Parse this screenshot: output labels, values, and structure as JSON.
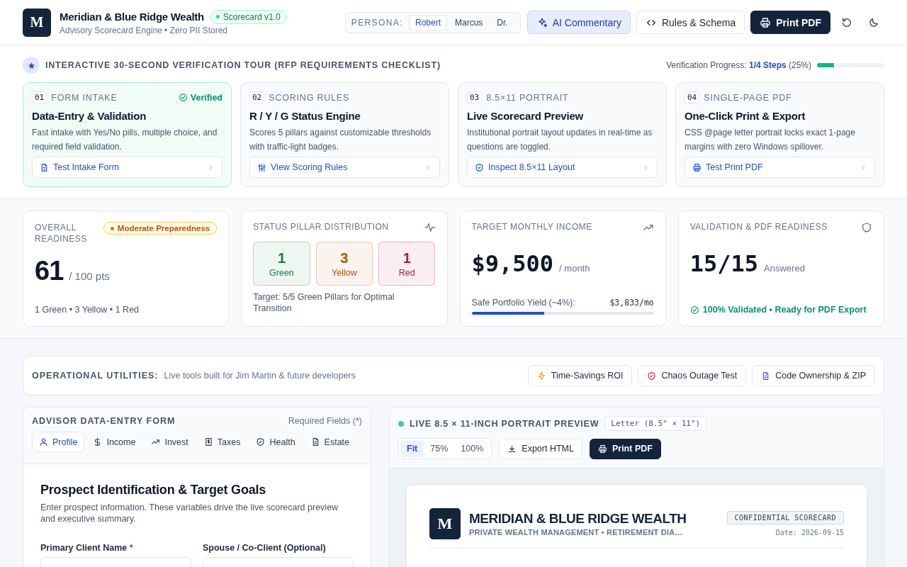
{
  "header": {
    "logo": "M",
    "title": "Meridian & Blue Ridge Wealth",
    "version": "Scorecard v1.0",
    "subtitle": "Advisory Scorecard Engine • Zero PII Stored",
    "persona": {
      "label": "PERSONA:",
      "options": [
        {
          "label": "Robert",
          "selected": true
        },
        {
          "label": "Marcus",
          "selected": false
        },
        {
          "label": "Dr.",
          "selected": false
        }
      ]
    },
    "buttons": [
      {
        "label": "AI Commentary",
        "kind": "accent"
      },
      {
        "label": "Rules & Schema",
        "kind": "outline"
      },
      {
        "label": "Print PDF",
        "kind": "dark"
      }
    ]
  },
  "tour": {
    "title": "INTERACTIVE 30-SECOND VERIFICATION TOUR (RFP REQUIREMENTS CHECKLIST)",
    "progress_label": "Verification Progress:",
    "progress_steps": "1/4 Steps",
    "progress_percent": "(25%)",
    "level": 0.25,
    "cards": [
      {
        "number": "01",
        "category": "FORM INTAKE",
        "verified": true,
        "verified_label": "Verified",
        "title": "Data-Entry & Validation",
        "description": "Fast intake with Yes/No pills, multiple choice, and required field validation.",
        "action": "Test Intake Form"
      },
      {
        "number": "02",
        "category": "SCORING RULES",
        "verified": false,
        "title": "R / Y / G Status Engine",
        "description": "Scores 5 pillars against customizable thresholds with traffic-light badges.",
        "action": "View Scoring Rules"
      },
      {
        "number": "03",
        "category": "8.5×11 PORTRAIT",
        "verified": false,
        "title": "Live Scorecard Preview",
        "description": "Institutional portrait layout updates in real-time as questions are toggled.",
        "action": "Inspect 8.5×11 Layout"
      },
      {
        "number": "04",
        "category": "SINGLE-PAGE PDF",
        "verified": false,
        "title": "One-Click Print & Export",
        "description": "CSS @page letter portrait locks exact 1-page margins with zero Windows spillover.",
        "action": "Test Print PDF"
      }
    ]
  },
  "stats": {
    "readiness": {
      "label": "OVERALL READINESS",
      "badge": "Moderate Preparedness",
      "score": "61",
      "out_of": "/ 100 pts",
      "summary": "1 Green • 3 Yellow • 1 Red"
    },
    "distribution": {
      "label": "STATUS PILLAR DISTRIBUTION",
      "pillars": [
        {
          "count": "1",
          "label": "Green",
          "color": "#15803d"
        },
        {
          "count": "3",
          "label": "Yellow",
          "color": "#b45309"
        },
        {
          "count": "1",
          "label": "Red",
          "color": "#be123c"
        }
      ],
      "target": "Target: 5/5 Green Pillars for Optimal Transition"
    },
    "income": {
      "label": "TARGET MONTHLY INCOME",
      "amount": "$9,500",
      "unit": "/ month",
      "yield_label": "Safe Portfolio Yield (~4%):",
      "yield_value": "$3,833/mo",
      "level": 0.4
    },
    "validation": {
      "label": "VALIDATION & PDF READINESS",
      "count": "15/15",
      "unit": "Answered",
      "status": "100% Validated • Ready for PDF Export"
    }
  },
  "utilities": {
    "title": "OPERATIONAL UTILITIES:",
    "subtitle": "Live tools built for Jim Martin & future developers",
    "buttons": [
      {
        "label": "Time-Savings ROI"
      },
      {
        "label": "Chaos Outage Test"
      },
      {
        "label": "Code Ownership & ZIP"
      }
    ]
  },
  "form": {
    "title": "ADVISOR DATA-ENTRY FORM",
    "required_note": {
      "before": "Required Fields (",
      "mark": "*",
      "after": ")"
    },
    "tabs": [
      {
        "label": "Profile",
        "selected": true
      },
      {
        "label": "Income",
        "selected": false
      },
      {
        "label": "Invest",
        "selected": false
      },
      {
        "label": "Taxes",
        "selected": false
      },
      {
        "label": "Health",
        "selected": false
      },
      {
        "label": "Estate",
        "selected": false
      }
    ],
    "section_title": "Prospect Identification & Target Goals",
    "section_description": "Enter prospect information. These variables drive the live scorecard preview and executive summary.",
    "fields": [
      {
        "label": "Primary Client Name",
        "required_mark": "*"
      },
      {
        "label": "Spouse / Co-Client (Optional)"
      }
    ]
  },
  "preview": {
    "title": "LIVE 8.5 × 11-INCH PORTRAIT PREVIEW",
    "paper": "Letter (8.5\" × 11\")",
    "zoom": [
      {
        "label": "Fit",
        "selected": true
      },
      {
        "label": "75%",
        "selected": false
      },
      {
        "label": "100%",
        "selected": false
      }
    ],
    "export_label": "Export HTML",
    "print_label": "Print PDF",
    "page": {
      "logo": "M",
      "firm": "MERIDIAN & BLUE RIDGE WEALTH",
      "tagline": "PRIVATE WEALTH MANAGEMENT • RETIREMENT DIA…",
      "badge": "CONFIDENTIAL SCORECARD",
      "date": "Date: 2026-09-15"
    }
  }
}
